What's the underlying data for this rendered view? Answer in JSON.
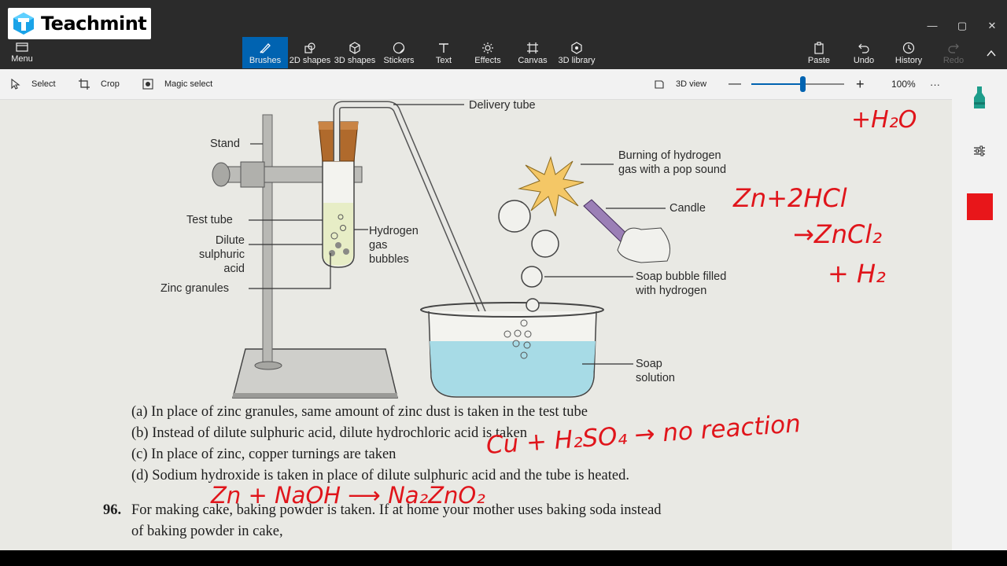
{
  "logo": {
    "text": "Teachmint"
  },
  "window": {
    "minimize": "—",
    "maximize": "▢",
    "close": "✕"
  },
  "ribbon": {
    "menu": "Menu",
    "tools": [
      {
        "label": "Brushes",
        "icon": "brush-icon"
      },
      {
        "label": "2D shapes",
        "icon": "2d-shapes-icon"
      },
      {
        "label": "3D shapes",
        "icon": "3d-shapes-icon"
      },
      {
        "label": "Stickers",
        "icon": "stickers-icon"
      },
      {
        "label": "Text",
        "icon": "text-icon"
      },
      {
        "label": "Effects",
        "icon": "effects-icon"
      },
      {
        "label": "Canvas",
        "icon": "canvas-icon"
      },
      {
        "label": "3D library",
        "icon": "3d-library-icon"
      }
    ],
    "paste": "Paste",
    "undo": "Undo",
    "history": "History",
    "redo": "Redo"
  },
  "toolbar2": {
    "select": "Select",
    "crop": "Crop",
    "magic_select": "Magic select",
    "view_3d": "3D view",
    "zoom": "100%",
    "zoom_level": 0.55,
    "more": "···"
  },
  "right_panel": {
    "color": "#e8161a"
  },
  "diagram": {
    "labels": {
      "delivery_tube": "Delivery tube",
      "stand": "Stand",
      "test_tube": "Test tube",
      "dilute1": "Dilute",
      "dilute2": "sulphuric",
      "dilute3": "acid",
      "zinc": "Zinc granules",
      "hydrogen1": "Hydrogen",
      "hydrogen2": "gas",
      "hydrogen3": "bubbles",
      "burning1": "Burning of hydrogen",
      "burning2": "gas with a pop sound",
      "candle": "Candle",
      "soap_bubble1": "Soap bubble filled",
      "soap_bubble2": "with hydrogen",
      "soap1": "Soap",
      "soap2": "solution"
    }
  },
  "questions": {
    "a": "(a) In place of zinc granules, same amount of zinc dust is taken in the test tube",
    "b": "(b) Instead of dilute sulphuric acid, dilute hydrochloric acid is taken",
    "c": "(c) In place of zinc, copper turnings are taken",
    "d": "(d) Sodium hydroxide is taken in place of dilute sulphuric acid and the tube is heated.",
    "q96_num": "96.",
    "q96_line1": "For making cake, baking powder is taken. If at home your mother uses baking soda instead",
    "q96_line2": "of baking powder in cake,"
  },
  "handwriting": {
    "top_right": "+H₂O",
    "eq1_a": "Zn+2HCl",
    "eq1_b": "→ZnCl₂",
    "eq1_c": "+ H₂",
    "copper_eq": "Cu + H₂SO₄ → no reaction",
    "naoh_eq": "Zn + NaOH ⟶ Na₂ZnO₂"
  }
}
